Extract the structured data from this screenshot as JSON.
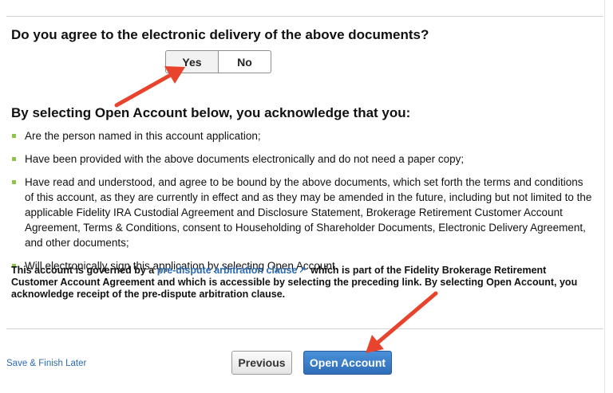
{
  "question": "Do you agree to the electronic delivery of the above documents?",
  "toggle": {
    "yes_label": "Yes",
    "no_label": "No"
  },
  "acknowledgement": {
    "title": "By selecting Open Account below, you acknowledge that you:",
    "items": [
      "Are the person named in this account application;",
      "Have been provided with the above documents electronically and do not need a paper copy;",
      "Have read and understood, and agree to be bound by the above documents, which set forth the terms and conditions of this account, as they are currently in effect and as they may be amended in the future, including but not limited to the applicable Fidelity IRA Custodial Agreement and Disclosure Statement, Brokerage Retirement Customer Account Agreement, Terms & Conditions, consent to Householding of Shareholder Documents, Electronic Delivery Agreement, and other documents;",
      "Will electronically sign this application by selecting Open Account."
    ]
  },
  "governed": {
    "prefix": "This account is governed by a ",
    "link_text": "pre-dispute arbitration clause",
    "link_icon": "external-link-icon",
    "suffix": " which is part of the Fidelity Brokerage Retirement Customer Account Agreement and which is accessible by selecting the preceding link. By selecting Open Account, you acknowledge receipt of the pre-dispute arbitration clause."
  },
  "footer": {
    "save_label": "Save & Finish Later",
    "previous_label": "Previous",
    "open_label": "Open Account"
  },
  "colors": {
    "link": "#2b6cb5",
    "primary_button": "#3a7ccb",
    "bullet": "#8fc546",
    "annotation_arrow": "#e8432c"
  }
}
